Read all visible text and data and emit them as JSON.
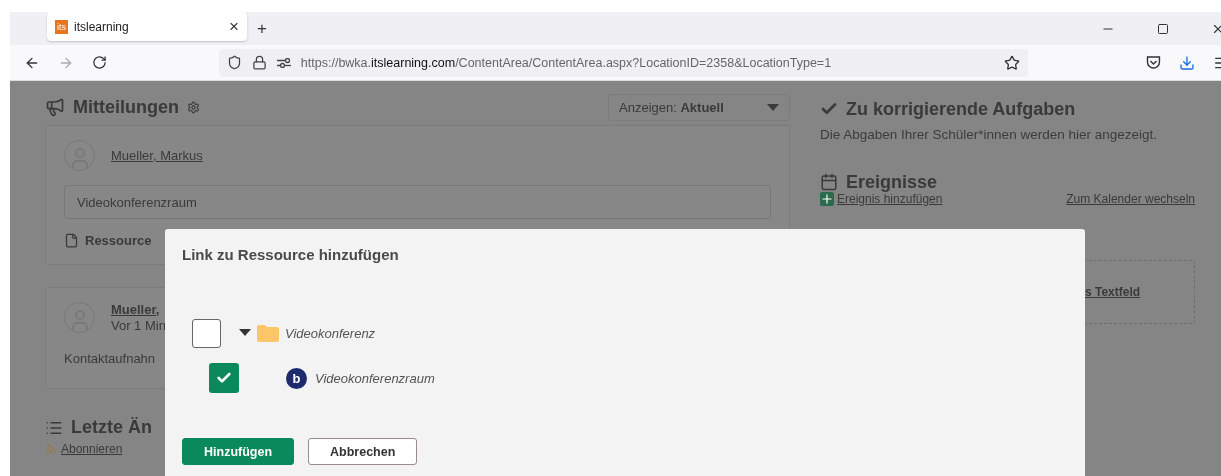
{
  "browser": {
    "tab": {
      "favicon_text": "its",
      "title": "itslearning",
      "close": "×"
    },
    "new_tab": "+",
    "url": {
      "scheme": "https://bwka.",
      "domain": "itslearning.com",
      "path": "/ContentArea/ContentArea.aspx?LocationID=2358&LocationType=1"
    }
  },
  "announcements": {
    "title": "Mitteilungen",
    "filter_label": "Anzeigen:",
    "filter_value": "Aktuell",
    "composer": {
      "author": "Mueller, Markus",
      "message": "Videokonferenzraum",
      "resource": "Ressource"
    },
    "post": {
      "author": "Mueller,",
      "time": "Vor 1 Min",
      "text": "Kontaktaufnahn"
    }
  },
  "recent": {
    "title": "Letzte Än",
    "subscribe": "Abonnieren"
  },
  "tasks": {
    "title": "Zu korrigierende Aufgaben",
    "text": "Die Abgaben Ihrer Schüler*innen werden hier angezeigt."
  },
  "events": {
    "title": "Ereignisse",
    "add": "Ereignis hinzufügen",
    "calendar": "Zum Kalender wechseln"
  },
  "textfield_link": "s Textfeld",
  "dialog": {
    "title": "Link zu Ressource hinzufügen",
    "items": [
      {
        "kind": "folder",
        "label": "Videokonferenz",
        "checked": false,
        "expanded": true,
        "children": [
          {
            "kind": "conference",
            "logo_text": "b",
            "label": "Videokonferenzraum",
            "checked": true
          }
        ]
      }
    ],
    "buttons": [
      {
        "kind": "primary",
        "label": "Hinzufügen"
      },
      {
        "kind": "secondary",
        "label": "Abbrechen"
      }
    ]
  }
}
